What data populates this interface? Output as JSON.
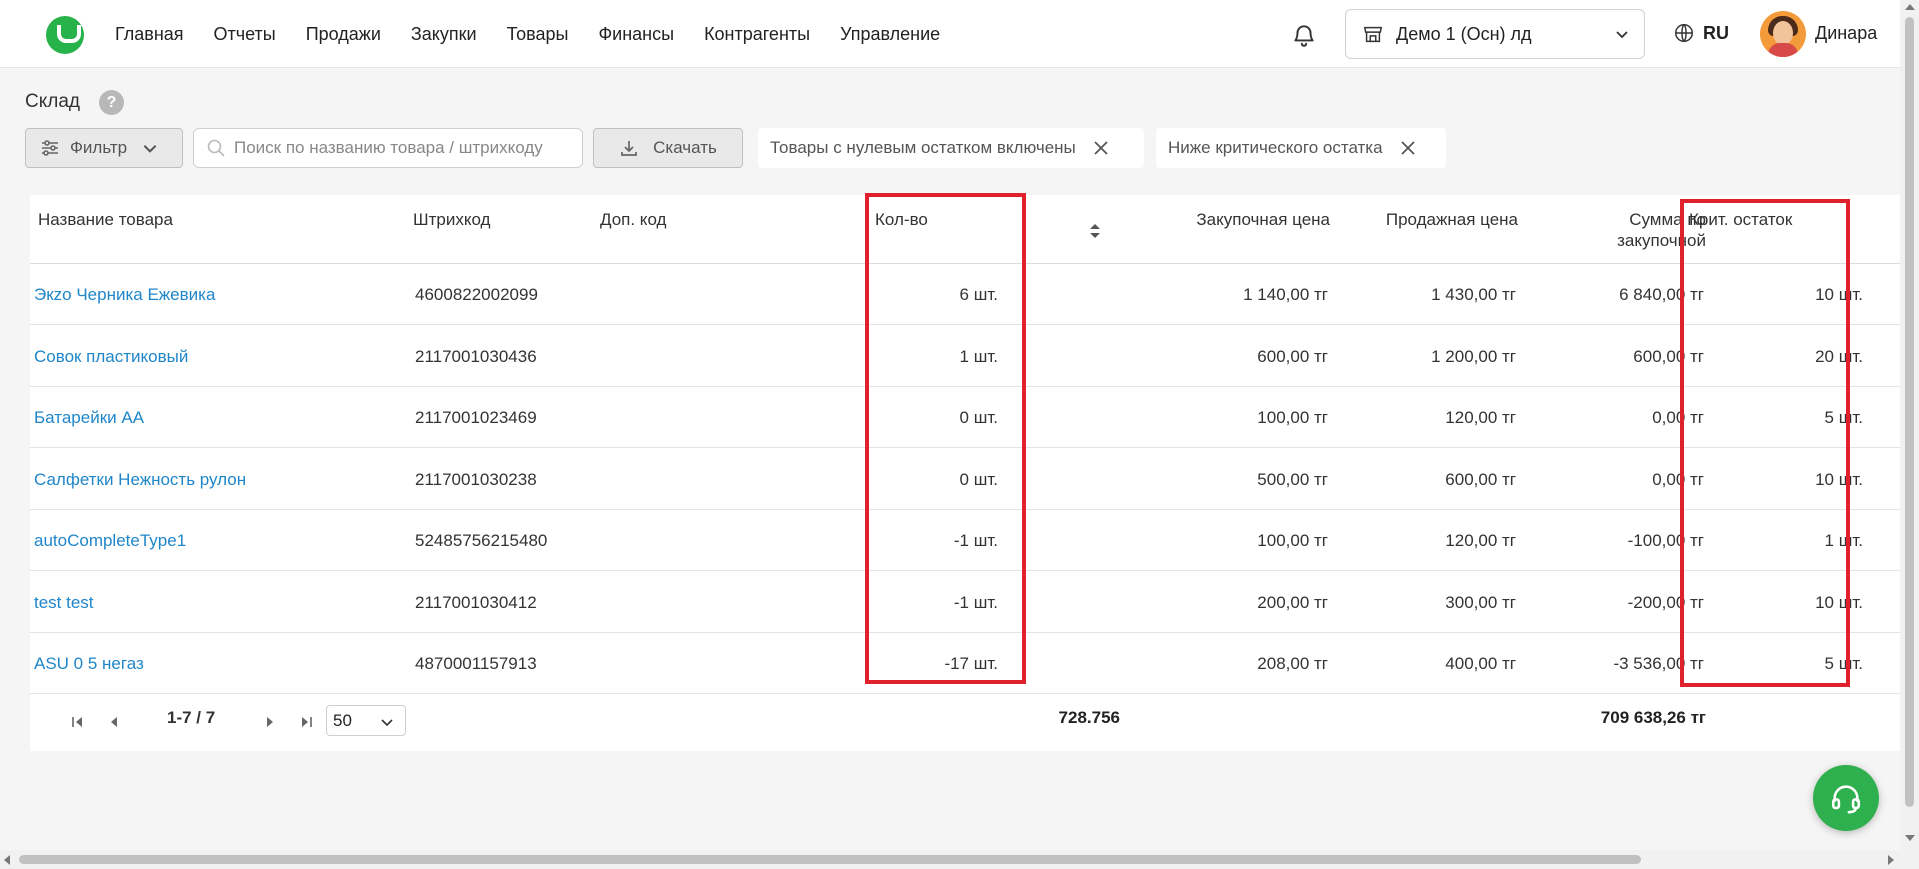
{
  "nav": {
    "items": [
      "Главная",
      "Отчеты",
      "Продажи",
      "Закупки",
      "Товары",
      "Финансы",
      "Контрагенты",
      "Управление"
    ]
  },
  "header": {
    "org": "Демо 1 (Осн) лд",
    "lang": "RU",
    "user": "Динара"
  },
  "page": {
    "title": "Склад",
    "help": "?"
  },
  "toolbar": {
    "filter_label": "Фильтр",
    "search_placeholder": "Поиск по названию товара / штрихкоду",
    "download_label": "Скачать",
    "chips": [
      "Товары с нулевым остатком включены",
      "Ниже критического остатка"
    ]
  },
  "table": {
    "columns": {
      "name": "Название товара",
      "barcode": "Штрихкод",
      "extra_code": "Доп. код",
      "qty": "Кол-во",
      "purchase_price": "Закупочная цена",
      "sale_price": "Продажная цена",
      "sum_line1": "Сумма по",
      "sum_line2": "закупочной",
      "crit": "Крит. остаток"
    },
    "rows": [
      {
        "name": "Экzo Черника Ежевика",
        "barcode": "4600822002099",
        "extra": "",
        "qty": "6 шт.",
        "purchase": "1 140,00 тг",
        "sale": "1 430,00 тг",
        "sum": "6 840,00 тг",
        "crit": "10 шт."
      },
      {
        "name": "Совок пластиковый",
        "barcode": "2117001030436",
        "extra": "",
        "qty": "1 шт.",
        "purchase": "600,00 тг",
        "sale": "1 200,00 тг",
        "sum": "600,00 тг",
        "crit": "20 шт."
      },
      {
        "name": "Батарейки АА",
        "barcode": "2117001023469",
        "extra": "",
        "qty": "0 шт.",
        "purchase": "100,00 тг",
        "sale": "120,00 тг",
        "sum": "0,00 тг",
        "crit": "5 шт."
      },
      {
        "name": "Салфетки Нежность рулон",
        "barcode": "2117001030238",
        "extra": "",
        "qty": "0 шт.",
        "purchase": "500,00 тг",
        "sale": "600,00 тг",
        "sum": "0,00 тг",
        "crit": "10 шт."
      },
      {
        "name": "autoCompleteType1",
        "barcode": "52485756215480",
        "extra": "",
        "qty": "-1 шт.",
        "purchase": "100,00 тг",
        "sale": "120,00 тг",
        "sum": "-100,00 тг",
        "crit": "1 шт."
      },
      {
        "name": "test test",
        "barcode": "2117001030412",
        "extra": "",
        "qty": "-1 шт.",
        "purchase": "200,00 тг",
        "sale": "300,00 тг",
        "sum": "-200,00 тг",
        "crit": "10 шт."
      },
      {
        "name": "ASU 0 5 негаз",
        "barcode": "4870001157913",
        "extra": "",
        "qty": "-17 шт.",
        "purchase": "208,00 тг",
        "sale": "400,00 тг",
        "sum": "-3 536,00 тг",
        "crit": "5 шт."
      }
    ]
  },
  "pagination": {
    "range": "1-7 / 7",
    "per_page": "50"
  },
  "totals": {
    "qty": "728.756",
    "sum": "709 638,26 тг"
  },
  "colors": {
    "accent": "#27b24a",
    "link": "#1f86c9",
    "highlight": "#e0202a"
  }
}
